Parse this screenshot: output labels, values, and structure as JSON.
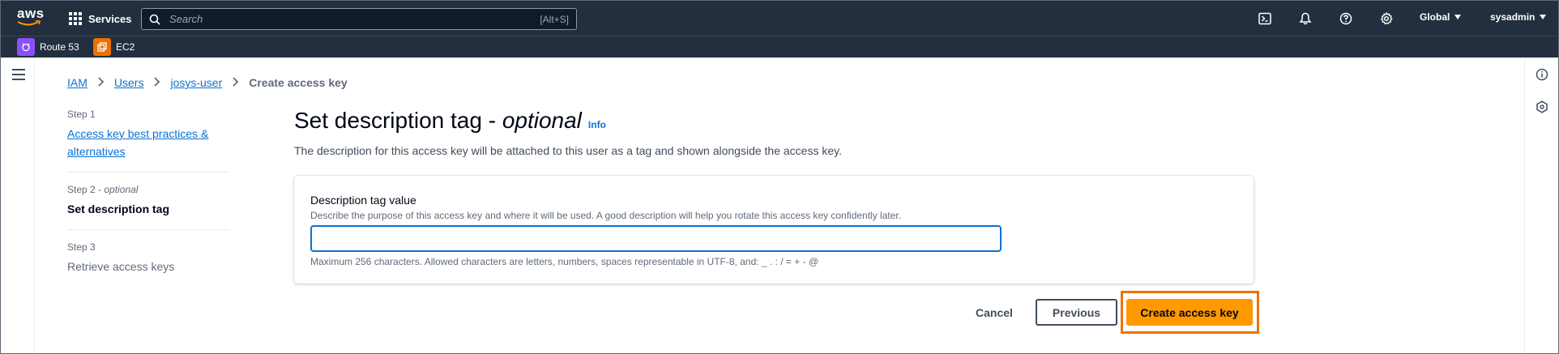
{
  "topnav": {
    "logo_text": "aws",
    "services_label": "Services",
    "search_placeholder": "Search",
    "search_shortcut": "[Alt+S]",
    "region_label": "Global",
    "account_label": "sysadmin",
    "icons": [
      "cloudshell-icon",
      "notifications-icon",
      "help-icon",
      "settings-icon"
    ]
  },
  "favorites": [
    {
      "label": "Route 53",
      "icon": "route53-icon",
      "color": "#8c4fff"
    },
    {
      "label": "EC2",
      "icon": "ec2-icon",
      "color": "#ed7100"
    }
  ],
  "breadcrumb": {
    "items": [
      "IAM",
      "Users",
      "josys-user"
    ],
    "current": "Create access key"
  },
  "steps": [
    {
      "num": "Step 1",
      "title": "Access key best practices & alternatives",
      "state": "link"
    },
    {
      "num": "Step 2",
      "num_suffix": "optional",
      "title": "Set description tag",
      "state": "active"
    },
    {
      "num": "Step 3",
      "title": "Retrieve access keys",
      "state": "disabled"
    }
  ],
  "main": {
    "heading": "Set description tag -",
    "heading_italic": "optional",
    "info_label": "Info",
    "description": "The description for this access key will be attached to this user as a tag and shown alongside the access key."
  },
  "form": {
    "label": "Description tag value",
    "description": "Describe the purpose of this access key and where it will be used. A good description will help you rotate this access key confidently later.",
    "value": "",
    "constraint": "Maximum 256 characters. Allowed characters are letters, numbers, spaces representable in UTF-8, and: _ . : / = + - @"
  },
  "actions": {
    "cancel": "Cancel",
    "previous": "Previous",
    "create": "Create access key"
  },
  "colors": {
    "nav_bg": "#232f3e",
    "link": "#0972d3",
    "primary": "#ff9900",
    "highlight": "#ec7211"
  }
}
